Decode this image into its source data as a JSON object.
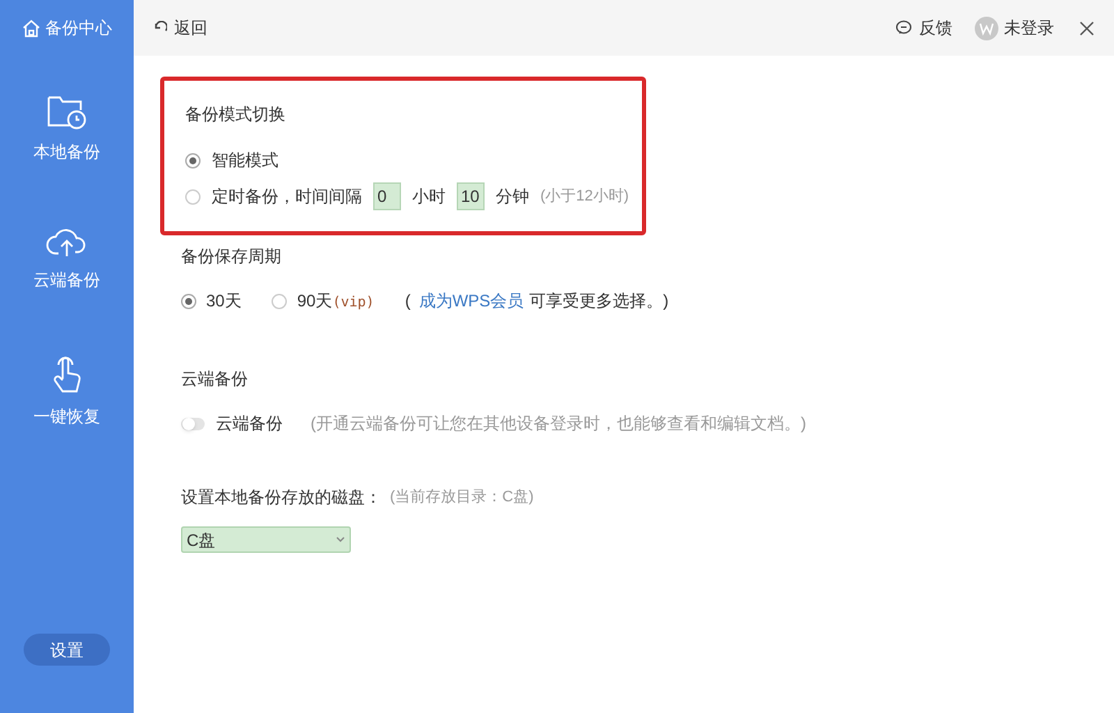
{
  "sidebar": {
    "title": "备份中心",
    "items": [
      {
        "kind": "local",
        "label": "本地备份"
      },
      {
        "kind": "cloud",
        "label": "云端备份"
      },
      {
        "kind": "restore",
        "label": "一键恢复"
      }
    ],
    "settings_button": "设置"
  },
  "header": {
    "back": "返回",
    "feedback": "反馈",
    "user": "未登录"
  },
  "mode": {
    "title": "备份模式切换",
    "highlighted": true,
    "options": [
      {
        "kind": "plain",
        "label": "智能模式",
        "selected": true
      },
      {
        "kind": "timed",
        "label": "定时备份，时间间隔",
        "hours": "0",
        "hours_unit": "小时",
        "minutes": "10",
        "minutes_unit": "分钟",
        "note": "(小于12小时)",
        "selected": false
      }
    ]
  },
  "retention": {
    "title": "备份保存周期",
    "options": [
      {
        "label": "30天",
        "selected": true
      },
      {
        "label": "90天",
        "suffix": "(vip)",
        "selected": false
      }
    ],
    "note_open": "(",
    "link": "成为WPS会员",
    "note_rest": "可享受更多选择。)"
  },
  "cloud": {
    "title": "云端备份",
    "toggle": {
      "label": "云端备份",
      "on": false
    },
    "hint": "(开通云端备份可让您在其他设备登录时，也能够查看和编辑文档。)"
  },
  "disk": {
    "label": "设置本地备份存放的磁盘：",
    "current": "(当前存放目录：C盘)",
    "value": "C盘"
  }
}
